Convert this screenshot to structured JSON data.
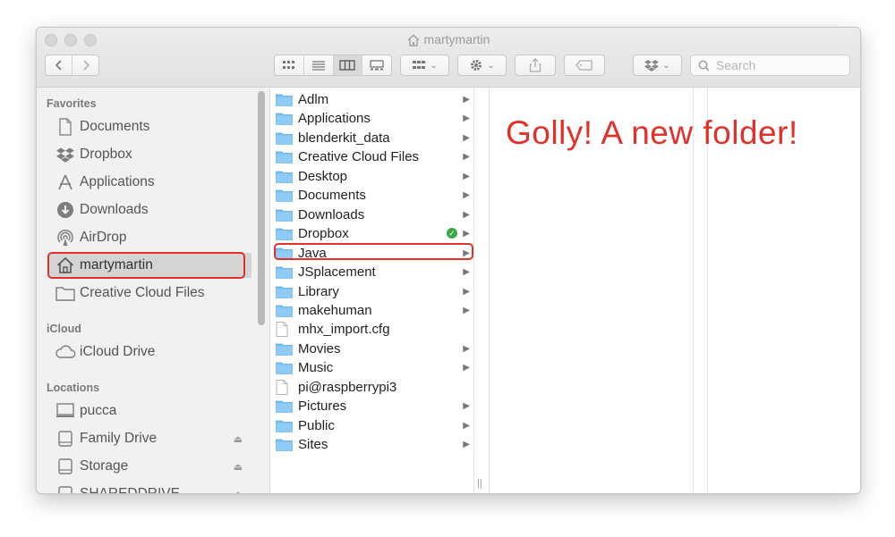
{
  "window": {
    "title": "martymartin"
  },
  "toolbar": {
    "back_icon": "chevron-left-icon",
    "forward_icon": "chevron-right-icon",
    "view_modes": [
      "icon-view-icon",
      "list-view-icon",
      "column-view-icon",
      "gallery-view-icon"
    ],
    "active_view": "column-view-icon",
    "search_placeholder": "Search"
  },
  "sidebar": {
    "favorites_label": "Favorites",
    "favorites": [
      {
        "label": "Documents",
        "icon": "document-icon"
      },
      {
        "label": "Dropbox",
        "icon": "dropbox-icon"
      },
      {
        "label": "Applications",
        "icon": "applications-icon"
      },
      {
        "label": "Downloads",
        "icon": "download-icon"
      },
      {
        "label": "AirDrop",
        "icon": "airdrop-icon"
      },
      {
        "label": "martymartin",
        "icon": "home-icon",
        "selected": true
      },
      {
        "label": "Creative Cloud Files",
        "icon": "folder-icon"
      }
    ],
    "icloud_label": "iCloud",
    "icloud": [
      {
        "label": "iCloud Drive",
        "icon": "cloud-icon"
      }
    ],
    "locations_label": "Locations",
    "locations": [
      {
        "label": "pucca",
        "icon": "computer-icon"
      },
      {
        "label": "Family Drive",
        "icon": "drive-icon",
        "eject": true
      },
      {
        "label": "Storage",
        "icon": "drive-icon",
        "eject": true
      },
      {
        "label": "SHAREDDRIVE",
        "icon": "drive-icon",
        "eject": true
      }
    ]
  },
  "column1": {
    "items": [
      {
        "label": "Adlm",
        "kind": "folder",
        "arrow": true
      },
      {
        "label": "Applications",
        "kind": "folder",
        "arrow": true
      },
      {
        "label": "blenderkit_data",
        "kind": "folder",
        "arrow": true
      },
      {
        "label": "Creative Cloud Files",
        "kind": "folder",
        "arrow": true
      },
      {
        "label": "Desktop",
        "kind": "folder",
        "arrow": true
      },
      {
        "label": "Documents",
        "kind": "folder",
        "arrow": true
      },
      {
        "label": "Downloads",
        "kind": "folder",
        "arrow": true
      },
      {
        "label": "Dropbox",
        "kind": "folder",
        "arrow": true,
        "synced": true
      },
      {
        "label": "Java",
        "kind": "folder",
        "arrow": true,
        "highlighted": true
      },
      {
        "label": "JSplacement",
        "kind": "folder",
        "arrow": true
      },
      {
        "label": "Library",
        "kind": "folder",
        "arrow": true
      },
      {
        "label": "makehuman",
        "kind": "folder",
        "arrow": true
      },
      {
        "label": "mhx_import.cfg",
        "kind": "file",
        "arrow": false
      },
      {
        "label": "Movies",
        "kind": "folder",
        "arrow": true
      },
      {
        "label": "Music",
        "kind": "folder",
        "arrow": true
      },
      {
        "label": "pi@raspberrypi3",
        "kind": "file",
        "arrow": false
      },
      {
        "label": "Pictures",
        "kind": "folder",
        "arrow": true
      },
      {
        "label": "Public",
        "kind": "folder",
        "arrow": true
      },
      {
        "label": "Sites",
        "kind": "folder",
        "arrow": true
      }
    ]
  },
  "annotation": {
    "text": "Golly! A new folder!",
    "color": "#e0322a"
  },
  "colors": {
    "folder": "#6cb7ee",
    "highlight": "#e0322a",
    "sync_check": "#3aa843"
  }
}
